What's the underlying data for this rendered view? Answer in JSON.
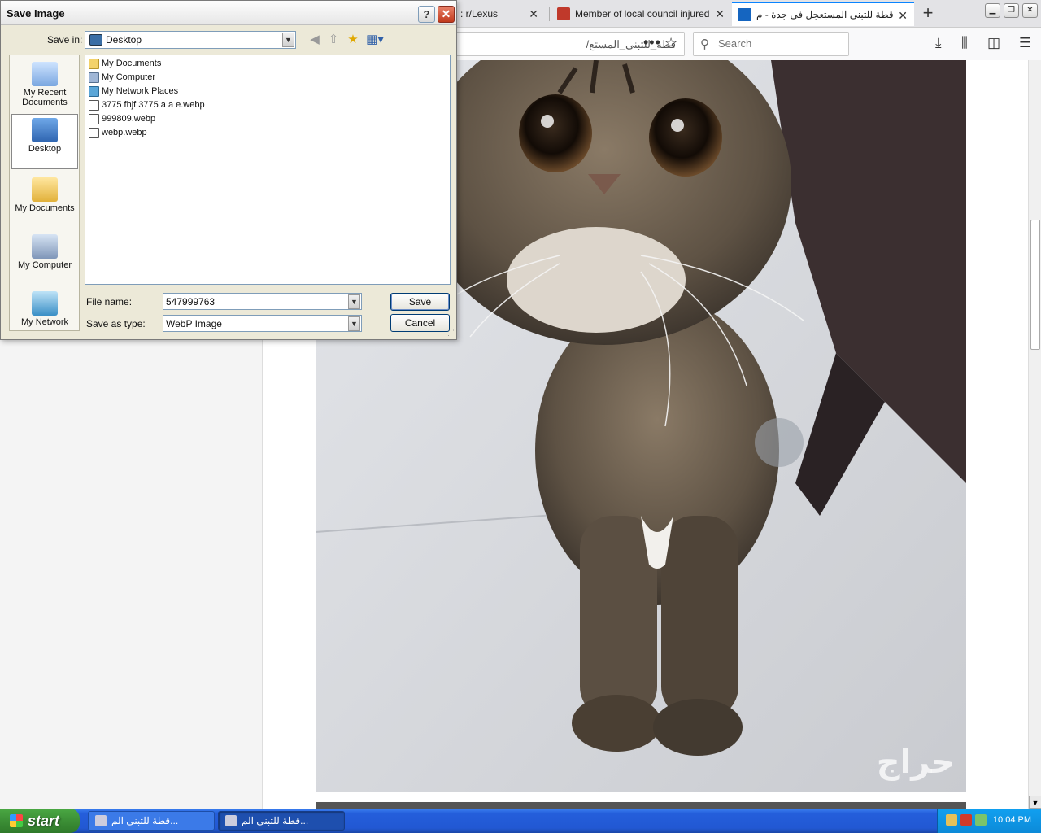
{
  "browser": {
    "tabs": [
      {
        "label": "h : r/Lexus",
        "active": false
      },
      {
        "label": "Member of local council injured in a",
        "active": false
      },
      {
        "label": "قطة للتبني المستعجل في جدة - م",
        "active": true
      }
    ],
    "new_tab_label": "+",
    "url_text": "قطة_للتبني_المستع/",
    "url_actions": "•••",
    "search_placeholder": "Search",
    "photo_watermark": "حراج",
    "window_buttons": {
      "minimize": "▁",
      "restore": "❐",
      "close": "✕"
    }
  },
  "dialog": {
    "title": "Save Image",
    "help_label": "?",
    "close_label": "✕",
    "save_in_label": "Save in:",
    "save_in_value": "Desktop",
    "places": [
      {
        "label": "My Recent Documents",
        "icon": "recent-documents-icon"
      },
      {
        "label": "Desktop",
        "icon": "desktop-icon",
        "active": true
      },
      {
        "label": "My Documents",
        "icon": "my-documents-icon"
      },
      {
        "label": "My Computer",
        "icon": "my-computer-icon"
      },
      {
        "label": "My Network",
        "icon": "my-network-icon"
      }
    ],
    "files": [
      {
        "name": "My Documents",
        "icon": "folder-icon"
      },
      {
        "name": "My Computer",
        "icon": "computer-icon"
      },
      {
        "name": "My Network Places",
        "icon": "network-icon"
      },
      {
        "name": "3775 fhjf 3775 a a e.webp",
        "icon": "webp-file-icon"
      },
      {
        "name": "999809.webp",
        "icon": "webp-file-icon"
      },
      {
        "name": "webp.webp",
        "icon": "webp-file-icon"
      }
    ],
    "file_name_label": "File name:",
    "file_name_value": "547999763",
    "save_as_type_label": "Save as type:",
    "save_as_type_value": "WebP Image",
    "save_button": "Save",
    "cancel_button": "Cancel"
  },
  "taskbar": {
    "start_label": "start",
    "tasks": [
      {
        "label": "قطة للتبني الم..."
      },
      {
        "label": "قطة للتبني الم..."
      }
    ],
    "clock": "10:04 PM"
  },
  "colors": {
    "accent": "#0a84ff",
    "taskbar": "#245edb",
    "start": "#3c8f36",
    "dialog_bg": "#ece9d8"
  }
}
